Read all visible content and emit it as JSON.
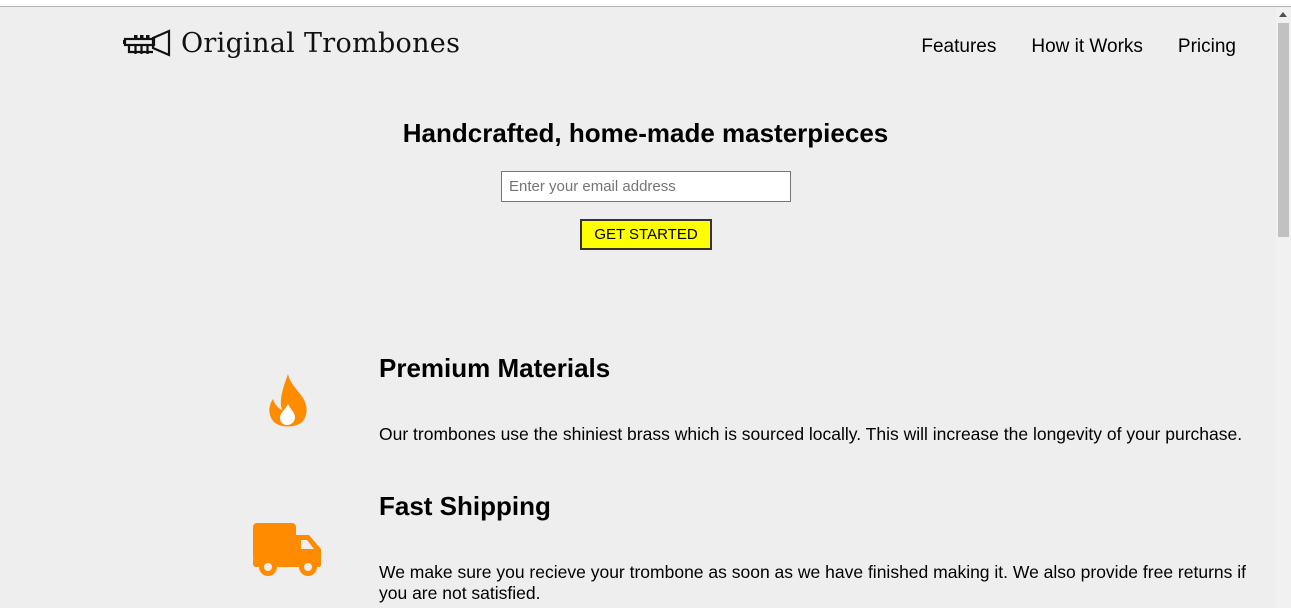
{
  "header": {
    "logo_icon": "trumpet-logo-icon",
    "brand": "Original Trombones",
    "nav": [
      "Features",
      "How it Works",
      "Pricing"
    ]
  },
  "hero": {
    "title": "Handcrafted, home-made masterpieces",
    "email_placeholder": "Enter your email address",
    "email_value": "",
    "cta_label": "GET STARTED",
    "cta_color": "#ffff00"
  },
  "features": [
    {
      "icon": "fire-icon",
      "title": "Premium Materials",
      "description": "Our trombones use the shiniest brass which is sourced locally. This will increase the longevity of your purchase."
    },
    {
      "icon": "truck-icon",
      "title": "Fast Shipping",
      "description": "We make sure you recieve your trombone as soon as we have finished making it. We also provide free returns if you are not satisfied."
    }
  ],
  "colors": {
    "accent": "#ff8c00",
    "background": "#eeeeee",
    "button": "#ffff00"
  }
}
